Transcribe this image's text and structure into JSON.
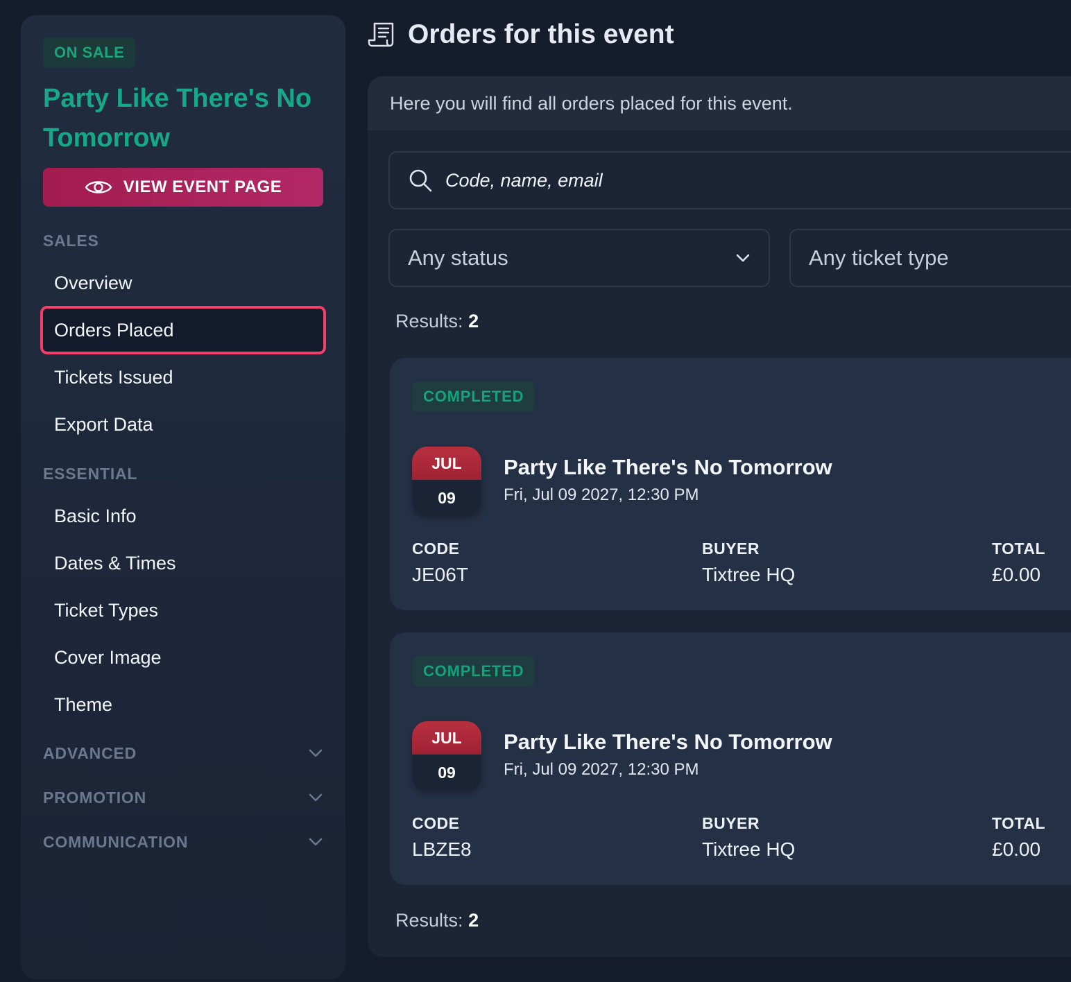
{
  "sidebar": {
    "status": "ON SALE",
    "event_title": "Party Like There's No Tomorrow",
    "view_button": "VIEW EVENT PAGE",
    "sections": {
      "sales": "SALES",
      "essential": "ESSENTIAL",
      "advanced": "ADVANCED",
      "promotion": "PROMOTION",
      "communication": "COMMUNICATION"
    },
    "sales_items": [
      "Overview",
      "Orders Placed",
      "Tickets Issued",
      "Export Data"
    ],
    "essential_items": [
      "Basic Info",
      "Dates & Times",
      "Ticket Types",
      "Cover Image",
      "Theme"
    ],
    "active_item": "Orders Placed"
  },
  "main": {
    "heading": "Orders for this event",
    "intro": "Here you will find all orders placed for this event.",
    "search_placeholder": "Code, name, email",
    "status_filter": "Any status",
    "ticket_filter": "Any ticket type",
    "results_label": "Results:",
    "results_count": "2"
  },
  "orders": [
    {
      "status": "COMPLETED",
      "month": "JUL",
      "day": "09",
      "event_name": "Party Like There's No Tomorrow",
      "event_date": "Fri, Jul 09 2027, 12:30 PM",
      "code_label": "CODE",
      "code": "JE06T",
      "buyer_label": "BUYER",
      "buyer": "Tixtree HQ",
      "total_label": "TOTAL",
      "total": "£0.00"
    },
    {
      "status": "COMPLETED",
      "month": "JUL",
      "day": "09",
      "event_name": "Party Like There's No Tomorrow",
      "event_date": "Fri, Jul 09 2027, 12:30 PM",
      "code_label": "CODE",
      "code": "LBZE8",
      "buyer_label": "BUYER",
      "buyer": "Tixtree HQ",
      "total_label": "TOTAL",
      "total": "£0.00"
    }
  ],
  "colors": {
    "accent_green": "#17a88a",
    "accent_pink": "#a21c4f",
    "active_outline": "#f43f6a",
    "background": "#151c2b"
  }
}
